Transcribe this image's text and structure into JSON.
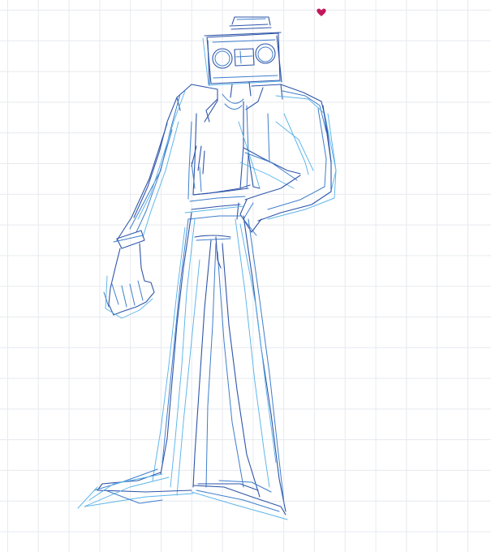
{
  "canvas": {
    "background": "#ffffff",
    "grid_color": "#e7e9ee"
  },
  "sketch": {
    "subject": "figure-with-boombox-head",
    "stroke_colors": {
      "dark": "#2f55a8",
      "medium": "#3f7ecb",
      "light": "#5bb4ea"
    }
  },
  "sticker": {
    "icon": "heart-icon",
    "color": "#c2185b"
  }
}
